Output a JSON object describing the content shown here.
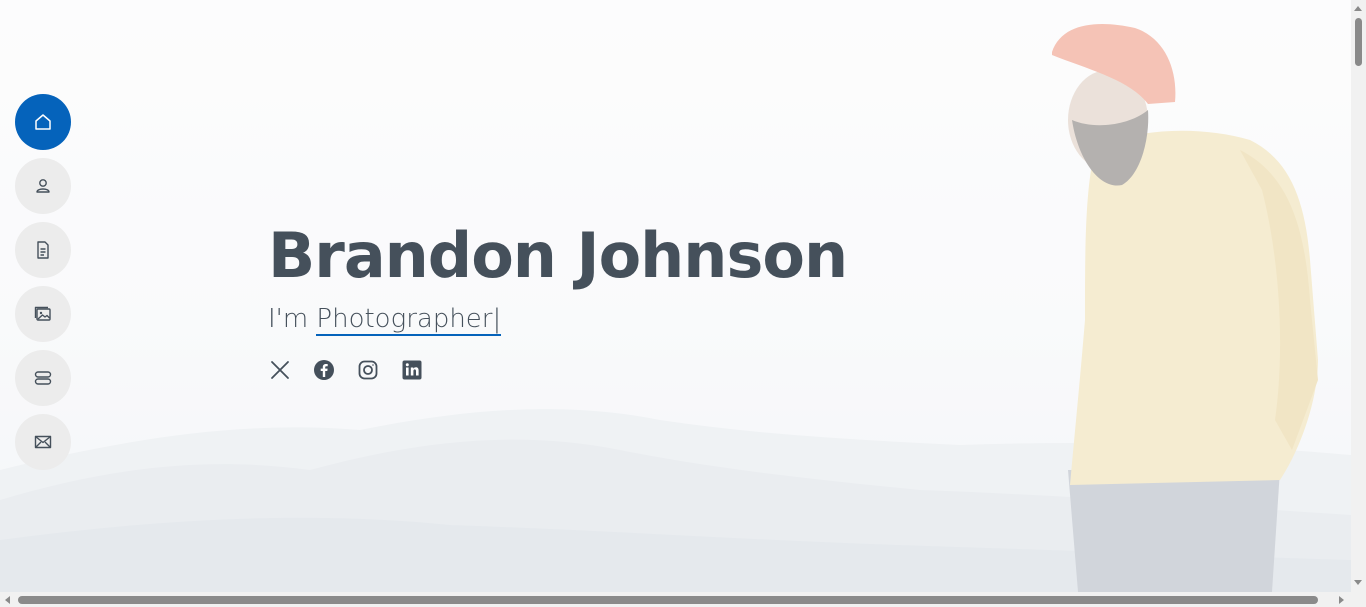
{
  "hero": {
    "name": "Brandon Johnson",
    "prefix": "I'm",
    "typed": "Photographer",
    "cursor": "|"
  },
  "nav": {
    "items": [
      {
        "icon": "house-icon",
        "active": true
      },
      {
        "icon": "person-icon",
        "active": false
      },
      {
        "icon": "file-text-icon",
        "active": false
      },
      {
        "icon": "images-icon",
        "active": false
      },
      {
        "icon": "server-icon",
        "active": false
      },
      {
        "icon": "envelope-icon",
        "active": false
      }
    ]
  },
  "social": [
    "x-twitter-icon",
    "facebook-icon",
    "instagram-icon",
    "linkedin-icon"
  ],
  "colors": {
    "accent": "#0563bb",
    "text": "#45505b",
    "nav_bg": "#ececec"
  }
}
